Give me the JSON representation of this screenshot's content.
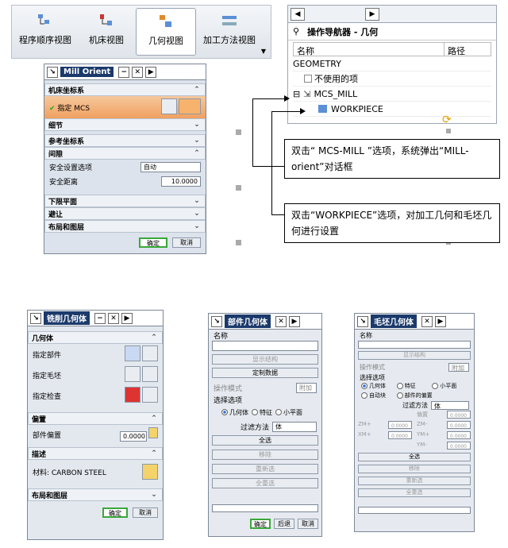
{
  "toolbar": {
    "items": [
      {
        "label": "程序顺序视图"
      },
      {
        "label": "机床视图"
      },
      {
        "label": "几何视图"
      },
      {
        "label": "加工方法视图"
      }
    ]
  },
  "navigator": {
    "title": "操作导航器 - 几何",
    "col_name": "名称",
    "col_path": "路径",
    "rows": [
      {
        "label": "GEOMETRY"
      },
      {
        "label": "不使用的项"
      },
      {
        "label": "MCS_MILL"
      },
      {
        "label": "WORKPIECE"
      }
    ]
  },
  "mill_orient": {
    "title": "Mill Orient",
    "sec_mcs": "机床坐标系",
    "specify_mcs": "指定 MCS",
    "detail": "细节",
    "sec_ref": "参考坐标系",
    "sec_gap": "间隙",
    "safe_opt_label": "安全设置选项",
    "safe_opt_val": "自动",
    "safe_dist_label": "安全距离",
    "safe_dist_val": "10.0000",
    "sec_lower": "下限平面",
    "sec_avoid": "避让",
    "sec_layout": "布局和图层",
    "ok": "确定",
    "cancel": "取消"
  },
  "notes": {
    "n1": "双击“ MCS-MILL ”选项，系统弹出“MILL-orient”对话框",
    "n2": "双击“WORKPIECE”选项，对加工几何和毛坯几何进行设置"
  },
  "mill_geom": {
    "title": "铣削几何体",
    "sec_geom": "几何体",
    "part": "指定部件",
    "blank": "指定毛坯",
    "check": "指定检查",
    "sec_offset": "偏置",
    "part_offset": "部件偏置",
    "offset_val": "0.0000",
    "sec_desc": "描述",
    "material": "材料: CARBON STEEL",
    "sec_layout": "布局和图层",
    "ok": "确定",
    "cancel": "取消"
  },
  "part_geom": {
    "title": "部件几何体",
    "name": "名称",
    "btn1": "显示结构",
    "btn2": "定制数据",
    "op_mode": "操作模式",
    "op_val": "附加",
    "sel_opt": "选择选项",
    "r1": "几何体",
    "r2": "特征",
    "r3": "小平面",
    "filter": "过滤方法",
    "filter_val": "体",
    "b_all": "全选",
    "b_rm": "移除",
    "b_redo": "重新选",
    "b_full": "全重选",
    "ok": "确定",
    "back": "后退",
    "cancel": "取消"
  },
  "blank_geom": {
    "title": "毛坯几何体",
    "name": "名称",
    "btn1": "显示结构",
    "op_mode": "操作模式",
    "op_val": "附加",
    "sel_opt": "选择选项",
    "r1": "几何体",
    "r2": "特征",
    "r3": "小平面",
    "r4": "自动块",
    "r5": "部件的偏置",
    "filter": "过滤方法",
    "filter_val": "体",
    "f1": "偏置",
    "f2": "ZM+",
    "f3": "ZM-",
    "f4": "XM+",
    "f5": "YM+",
    "f6": "YM-",
    "zero": "0.0000",
    "b_all": "全选",
    "b_rm": "移除",
    "b_redo": "重新选",
    "b_full": "全重选"
  },
  "colors": {
    "accent": "#1b3a6b",
    "ok": "#39a839",
    "mcs": "#f0a060"
  }
}
